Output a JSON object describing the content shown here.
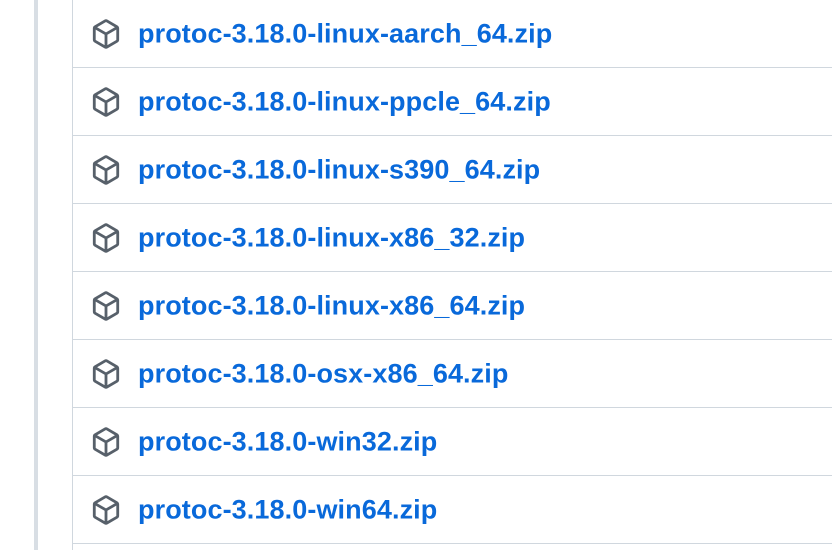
{
  "assets": [
    {
      "name": "protoc-3.18.0-linux-aarch_64.zip",
      "icon": "package-icon"
    },
    {
      "name": "protoc-3.18.0-linux-ppcle_64.zip",
      "icon": "package-icon"
    },
    {
      "name": "protoc-3.18.0-linux-s390_64.zip",
      "icon": "package-icon"
    },
    {
      "name": "protoc-3.18.0-linux-x86_32.zip",
      "icon": "package-icon"
    },
    {
      "name": "protoc-3.18.0-linux-x86_64.zip",
      "icon": "package-icon"
    },
    {
      "name": "protoc-3.18.0-osx-x86_64.zip",
      "icon": "package-icon"
    },
    {
      "name": "protoc-3.18.0-win32.zip",
      "icon": "package-icon"
    },
    {
      "name": "protoc-3.18.0-win64.zip",
      "icon": "package-icon"
    }
  ],
  "colors": {
    "link": "#0969da",
    "border": "#d0d7de",
    "icon": "#57606a",
    "timeline": "#d8dee4"
  }
}
